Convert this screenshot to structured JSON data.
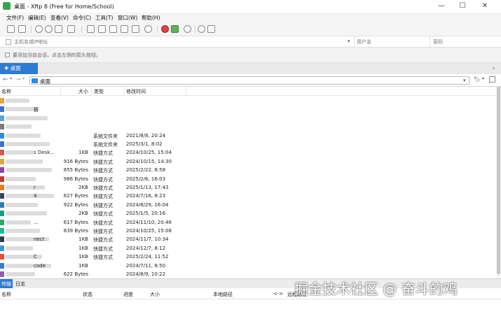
{
  "window": {
    "title": "桌面 - Xftp 8 (Free for Home/School)",
    "minimize": "—",
    "maximize": "☐",
    "close": "✕"
  },
  "menu": [
    "文件(F)",
    "编辑(E)",
    "查看(V)",
    "命令(C)",
    "工具(T)",
    "窗口(W)",
    "帮助(H)"
  ],
  "address_bar": {
    "host_placeholder": "主机名或IP地址",
    "username_placeholder": "用户名",
    "password_placeholder": "密码"
  },
  "hint": "要添加当前会话，点击左侧的箭头按钮。",
  "tab": {
    "label": "✚ 桌面"
  },
  "path": {
    "text": "桌面"
  },
  "columns": {
    "name": "名称",
    "size": "大小",
    "type": "类型",
    "modified": "修改时间"
  },
  "files": [
    {
      "name": "",
      "size": "",
      "type": "",
      "modified": "",
      "icon_color": "#e6a23c"
    },
    {
      "name": "板",
      "size": "",
      "type": "",
      "modified": "",
      "icon_color": "#3a6fd8"
    },
    {
      "name": "",
      "size": "",
      "type": "",
      "modified": "",
      "icon_color": "#5aa0e0"
    },
    {
      "name": "",
      "size": "",
      "type": "",
      "modified": "",
      "icon_color": "#7b7b7b"
    },
    {
      "name": "",
      "size": "",
      "type": "系统文件夹",
      "modified": "2021/8/8, 20:24",
      "icon_color": "#2b8be0"
    },
    {
      "name": "",
      "size": "",
      "type": "系统文件夹",
      "modified": "2025/3/1, 8:02",
      "icon_color": "#3a6fd8"
    },
    {
      "name": "s Desk...",
      "size": "1KB",
      "type": "快捷方式",
      "modified": "2024/10/25, 15:04",
      "icon_color": "#d9534f"
    },
    {
      "name": "",
      "size": "916 Bytes",
      "type": "快捷方式",
      "modified": "2024/10/15, 14:30",
      "icon_color": "#e6a23c"
    },
    {
      "name": "",
      "size": "855 Bytes",
      "type": "快捷方式",
      "modified": "2025/2/22, 8:58",
      "icon_color": "#8e44ad"
    },
    {
      "name": "",
      "size": "986 Bytes",
      "type": "快捷方式",
      "modified": "2025/2/6, 16:03",
      "icon_color": "#c0392b"
    },
    {
      "name": "r",
      "size": "2KB",
      "type": "快捷方式",
      "modified": "2025/1/13, 17:43",
      "icon_color": "#e67e22"
    },
    {
      "name": "4",
      "size": "627 Bytes",
      "type": "快捷方式",
      "modified": "2024/7/16, 8:23",
      "icon_color": "#34495e"
    },
    {
      "name": "",
      "size": "922 Bytes",
      "type": "快捷方式",
      "modified": "2024/8/29, 16:04",
      "icon_color": "#2980b9"
    },
    {
      "name": "",
      "size": "2KB",
      "type": "快捷方式",
      "modified": "2025/1/5, 20:16",
      "icon_color": "#16a085"
    },
    {
      "name": "...",
      "size": "617 Bytes",
      "type": "快捷方式",
      "modified": "2024/11/10, 20:46",
      "icon_color": "#27ae60"
    },
    {
      "name": "",
      "size": "839 Bytes",
      "type": "快捷方式",
      "modified": "2024/10/25, 15:08",
      "icon_color": "#1abc9c"
    },
    {
      "name": "nect",
      "size": "1KB",
      "type": "快捷方式",
      "modified": "2024/11/7, 10:34",
      "icon_color": "#2c3e50"
    },
    {
      "name": "",
      "size": "1KB",
      "type": "快捷方式",
      "modified": "2024/12/7, 8:12",
      "icon_color": "#3498db"
    },
    {
      "name": "C",
      "size": "1KB",
      "type": "快捷方式",
      "modified": "2025/2/24, 11:52",
      "icon_color": "#e74c3c"
    },
    {
      "name": "code",
      "size": "1KB",
      "type": "",
      "modified": "2024/7/11, 8:50",
      "icon_color": "#2f7bd4"
    },
    {
      "name": "",
      "size": "622 Bytes",
      "type": "",
      "modified": "2024/8/9, 10:22",
      "icon_color": "#9b59b6"
    }
  ],
  "bottom_tabs": {
    "transfer": "传输",
    "log": "日志"
  },
  "transfer_columns": [
    "名称",
    "状态",
    "进度",
    "大小",
    "本地路径",
    "<->",
    "远程路径"
  ],
  "watermark": "掘金技术社区 @ 奋斗的鸡",
  "icons": {
    "app": "xftp-icon",
    "path_folder": "folder-icon"
  },
  "colors": {
    "accent": "#2f7bd4"
  }
}
